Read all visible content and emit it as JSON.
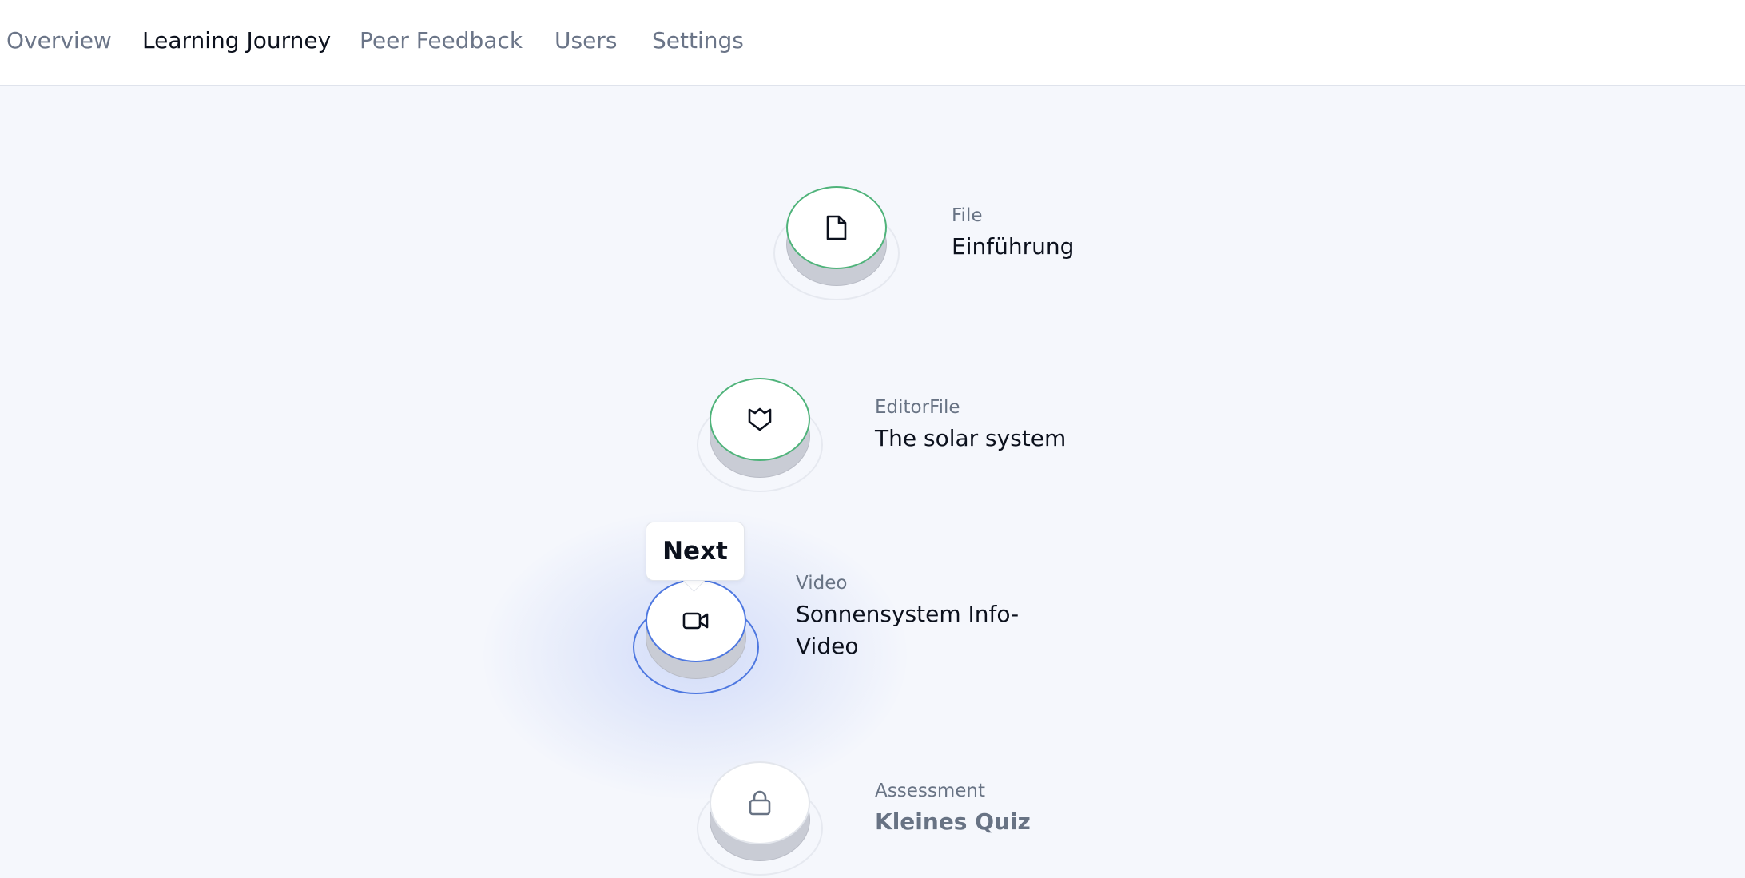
{
  "nav": {
    "tabs": [
      {
        "label": "Overview"
      },
      {
        "label": "Learning Journey"
      },
      {
        "label": "Peer Feedback"
      },
      {
        "label": "Users"
      },
      {
        "label": "Settings"
      }
    ]
  },
  "journey": {
    "steps": [
      {
        "type": "File",
        "title": "Einführung",
        "status": "completed",
        "icon": "file-icon"
      },
      {
        "type": "EditorFile",
        "title": "The solar system",
        "status": "completed",
        "icon": "shield-icon"
      },
      {
        "type": "Video",
        "title": "Sonnensystem Info-Video",
        "status": "current",
        "icon": "video-camera-icon"
      },
      {
        "type": "Assessment",
        "title": "Kleines Quiz",
        "status": "locked",
        "icon": "lock-icon"
      }
    ],
    "current_marker": "Next"
  },
  "colors": {
    "completed": "#4fb37a",
    "current": "#4d77e0",
    "text": "#0c111d",
    "muted": "#687384",
    "background": "#f5f7fc"
  }
}
